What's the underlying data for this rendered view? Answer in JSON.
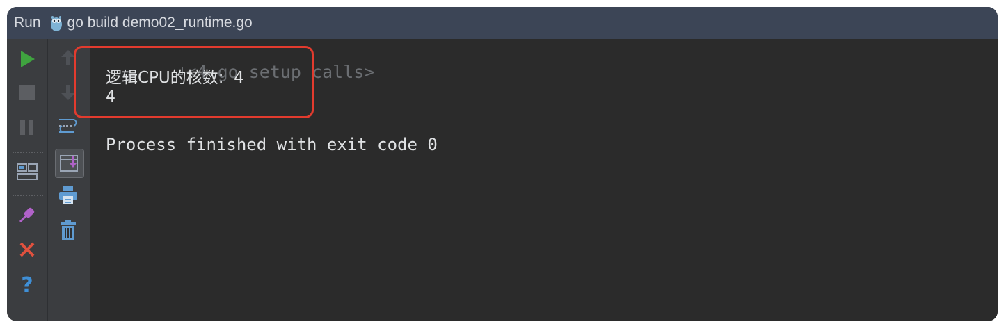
{
  "titlebar": {
    "run_label": "Run",
    "config_name": "go build demo02_runtime.go",
    "icon": "gopher-icon"
  },
  "toolbar_left": [
    {
      "name": "rerun-icon",
      "color": "#3fa33f"
    },
    {
      "name": "stop-icon",
      "color": "#6a6c70"
    },
    {
      "name": "pause-icon",
      "color": "#6a6c70"
    },
    {
      "name": "layout-icon",
      "color": "#9aa5b5"
    },
    {
      "name": "pin-icon",
      "color": "#b062c8"
    },
    {
      "name": "close-icon",
      "color": "#e0513e"
    },
    {
      "name": "help-icon",
      "color": "#3f8fd6"
    }
  ],
  "toolbar_right": [
    {
      "name": "up-arrow-icon"
    },
    {
      "name": "down-arrow-icon"
    },
    {
      "name": "soft-wrap-icon"
    },
    {
      "name": "scroll-to-end-icon"
    },
    {
      "name": "print-icon"
    },
    {
      "name": "trash-icon"
    }
  ],
  "console": {
    "fold_text": "<4 go setup calls>",
    "line1": "逻辑CPU的核数:  4",
    "line2": "4",
    "line3": "Process finished with exit code 0"
  },
  "highlight_color": "#e23b2e"
}
